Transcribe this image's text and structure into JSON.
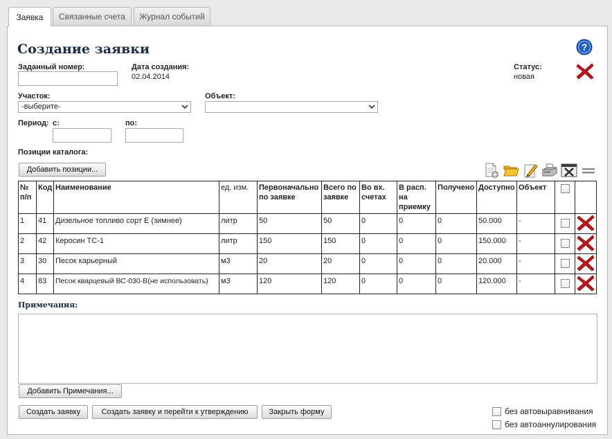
{
  "tabs": [
    "Заявка",
    "Связанные счета",
    "Журнал событий"
  ],
  "page_title": "Создание заявки",
  "fields": {
    "number_label": "Заданный номер:",
    "number_value": "",
    "created_label": "Дата создания:",
    "created_value": "02.04.2014",
    "status_label": "Статус:",
    "status_value": "новая",
    "site_label": "Участок:",
    "site_value": "-выберите-",
    "object_label": "Объект:",
    "object_value": "",
    "period_label": "Период:",
    "from_label": "с:",
    "to_label": "по:",
    "catalog_label": "Позиции каталога:"
  },
  "buttons": {
    "add_positions": "Добавить позиции...",
    "add_notes": "Добавить Примечания...",
    "create": "Создать заявку",
    "create_approve": "Создать заявку и перейти к утверждению",
    "close": "Закрыть форму"
  },
  "table": {
    "headers": [
      "№ п/п",
      "Код",
      "Наименование",
      "ед. изм.",
      "Первоначально по заявке",
      "Всего по заявке",
      "Во вх. счетах",
      "В расп. на приемку",
      "Получено",
      "Доступно",
      "Объект"
    ],
    "rows": [
      [
        "1",
        "41",
        "Дизельное топливо сорт Е (зимнее)",
        "литр",
        "50",
        "50",
        "0",
        "0",
        "0",
        "50.000",
        "-"
      ],
      [
        "2",
        "42",
        "Керосин ТС-1",
        "литр",
        "150",
        "150",
        "0",
        "0",
        "0",
        "150.000",
        "-"
      ],
      [
        "3",
        "30",
        "Песок карьерный",
        "м3",
        "20",
        "20",
        "0",
        "0",
        "0",
        "20.000",
        "-"
      ],
      [
        "4",
        "83",
        "Песок кварцевый ВС-030-В(не использовать)",
        "м3",
        "120",
        "120",
        "0",
        "0",
        "0",
        "120.000",
        "-"
      ]
    ]
  },
  "notes_label": "Примечания:",
  "options": {
    "no_autoalign": "без автовыравнивания",
    "no_autocancel": "без автоаннулирования"
  },
  "colors": {
    "title": "#1c2c44",
    "delete_red": "#c0141b",
    "help_blue": "#1d5fbf"
  },
  "icons": [
    "help-icon",
    "delete-icon",
    "add-document-icon",
    "open-folder-icon",
    "edit-icon",
    "print-icon",
    "excel-export-icon",
    "menu-icon"
  ]
}
